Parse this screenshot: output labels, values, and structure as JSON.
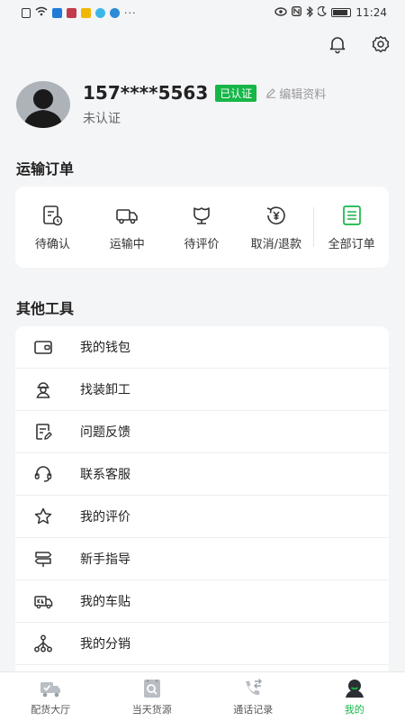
{
  "statusbar": {
    "time": "11:24",
    "dots": "···"
  },
  "profile": {
    "phone": "157****5563",
    "verified_badge": "已认证",
    "edit_label": "编辑资料",
    "status": "未认证"
  },
  "orders_section": {
    "title": "运输订单",
    "items": [
      {
        "label": "待确认",
        "icon": "pending-confirm-icon"
      },
      {
        "label": "运输中",
        "icon": "truck-icon"
      },
      {
        "label": "待评价",
        "icon": "review-icon"
      },
      {
        "label": "取消/退款",
        "icon": "refund-icon"
      },
      {
        "label": "全部订单",
        "icon": "all-orders-icon"
      }
    ]
  },
  "tools_section": {
    "title": "其他工具",
    "items": [
      {
        "label": "我的钱包",
        "icon": "wallet-icon"
      },
      {
        "label": "找装卸工",
        "icon": "worker-icon"
      },
      {
        "label": "问题反馈",
        "icon": "feedback-icon"
      },
      {
        "label": "联系客服",
        "icon": "headset-icon"
      },
      {
        "label": "我的评价",
        "icon": "star-icon"
      },
      {
        "label": "新手指导",
        "icon": "signpost-icon"
      },
      {
        "label": "我的车贴",
        "icon": "truck-sticker-icon"
      },
      {
        "label": "我的分销",
        "icon": "distribution-icon"
      }
    ]
  },
  "tabbar": {
    "items": [
      {
        "label": "配货大厅",
        "icon": "cargo-hall-icon"
      },
      {
        "label": "当天货源",
        "icon": "today-cargo-icon"
      },
      {
        "label": "通话记录",
        "icon": "call-log-icon"
      },
      {
        "label": "我的",
        "icon": "profile-icon"
      }
    ],
    "active_index": 3
  },
  "colors": {
    "accent": "#16b648",
    "background": "#f4f5f7"
  }
}
